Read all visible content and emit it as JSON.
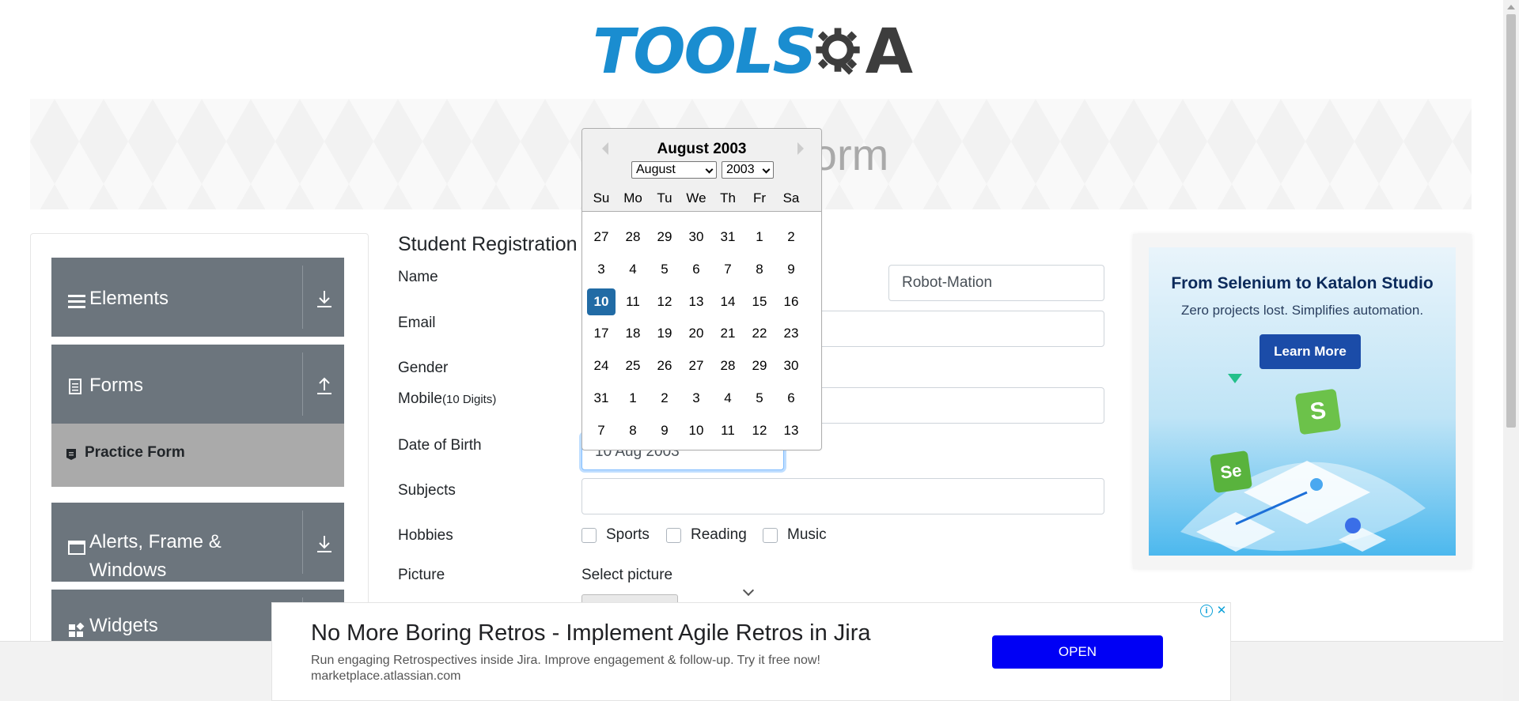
{
  "logo": {
    "text_left": "TOOLS",
    "text_right": "A",
    "alt": "TOOLSQA"
  },
  "banner": {
    "title": "Practice Form"
  },
  "sidebar": {
    "groups": [
      {
        "label": "Elements",
        "icon": "hamburger-icon",
        "arrow": "download-arrow-icon"
      },
      {
        "label": "Forms",
        "icon": "document-icon",
        "arrow": "upload-arrow-icon"
      },
      {
        "label": "Alerts, Frame & Windows",
        "icon": "window-icon",
        "arrow": "download-arrow-icon"
      },
      {
        "label": "Widgets",
        "icon": "widgets-icon",
        "arrow": "download-arrow-icon"
      }
    ],
    "active_item": {
      "label": "Practice Form",
      "icon": "form-icon"
    }
  },
  "form": {
    "title": "Student Registration Form",
    "labels": {
      "name": "Name",
      "email": "Email",
      "gender": "Gender",
      "mobile": "Mobile",
      "mobile_hint": "(10 Digits)",
      "dob": "Date of Birth",
      "subjects": "Subjects",
      "hobbies": "Hobbies",
      "picture": "Picture"
    },
    "values": {
      "last_name": "Robot-Mation",
      "dob": "10 Aug 2003",
      "subjects": "",
      "email": "",
      "mobile": ""
    },
    "hobbies": [
      "Sports",
      "Reading",
      "Music"
    ],
    "picture_label": "Select picture"
  },
  "datepicker": {
    "header": "August 2003",
    "month_select": "August",
    "year_select": "2003",
    "day_names": [
      "Su",
      "Mo",
      "Tu",
      "We",
      "Th",
      "Fr",
      "Sa"
    ],
    "weeks": [
      [
        "27",
        "28",
        "29",
        "30",
        "31",
        "1",
        "2"
      ],
      [
        "3",
        "4",
        "5",
        "6",
        "7",
        "8",
        "9"
      ],
      [
        "10",
        "11",
        "12",
        "13",
        "14",
        "15",
        "16"
      ],
      [
        "17",
        "18",
        "19",
        "20",
        "21",
        "22",
        "23"
      ],
      [
        "24",
        "25",
        "26",
        "27",
        "28",
        "29",
        "30"
      ],
      [
        "31",
        "1",
        "2",
        "3",
        "4",
        "5",
        "6"
      ],
      [
        "7",
        "8",
        "9",
        "10",
        "11",
        "12",
        "13"
      ]
    ],
    "selected_day": "10"
  },
  "ad_right": {
    "headline": "From Selenium to Katalon Studio",
    "subline": "Zero projects lost. Simplifies automation.",
    "button": "Learn More",
    "logo_s": "S",
    "logo_se": "Se"
  },
  "ad_bottom": {
    "title": "No More Boring Retros - Implement Agile Retros in Jira",
    "description": "Run engaging Retrospectives inside Jira. Improve engagement & follow-up. Try it free now!",
    "url": "marketplace.atlassian.com",
    "button": "OPEN",
    "info_glyph": "i",
    "close_glyph": "✕"
  },
  "colors": {
    "brand_blue": "#1a8dd0",
    "sidebar_bg": "#6c757d",
    "active_item_bg": "#aaaaaa",
    "selected_day": "#216ba5",
    "ad_button": "#0000f5"
  }
}
